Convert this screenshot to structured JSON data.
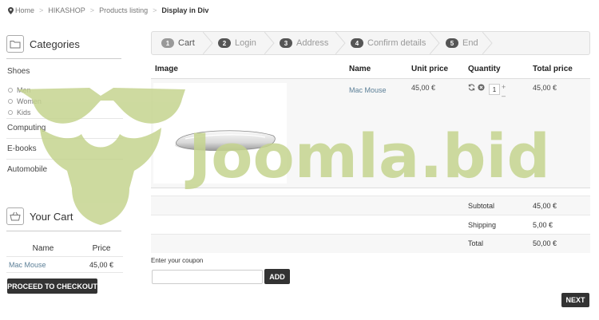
{
  "breadcrumb": {
    "items": [
      {
        "label": "Home"
      },
      {
        "label": "HIKASHOP"
      },
      {
        "label": "Products listing"
      },
      {
        "label": "Display in Div"
      }
    ]
  },
  "sidebar": {
    "categories_title": "Categories",
    "categories": [
      {
        "label": "Shoes",
        "children": [
          "Men",
          "Women",
          "Kids"
        ]
      },
      {
        "label": "Computing"
      },
      {
        "label": "E-books"
      },
      {
        "label": "Automobile"
      }
    ],
    "cart_title": "Your Cart",
    "cart_columns": {
      "name": "Name",
      "price": "Price"
    },
    "cart_items": [
      {
        "name": "Mac Mouse",
        "price": "45,00 €"
      }
    ],
    "checkout_label": "PROCEED TO CHECKOUT"
  },
  "steps": [
    {
      "num": "1",
      "label": "Cart"
    },
    {
      "num": "2",
      "label": "Login"
    },
    {
      "num": "3",
      "label": "Address"
    },
    {
      "num": "4",
      "label": "Confirm details"
    },
    {
      "num": "5",
      "label": "End"
    }
  ],
  "cart_table": {
    "headers": {
      "image": "Image",
      "name": "Name",
      "unit_price": "Unit price",
      "quantity": "Quantity",
      "total_price": "Total price"
    },
    "row": {
      "name": "Mac Mouse",
      "unit_price": "45,00 €",
      "quantity": "1",
      "total_price": "45,00 €"
    },
    "qty_plus": "+",
    "qty_minus": "–"
  },
  "summary": {
    "subtotal_label": "Subtotal",
    "subtotal": "45,00 €",
    "shipping_label": "Shipping",
    "shipping": "5,00 €",
    "total_label": "Total",
    "total": "50,00 €"
  },
  "coupon": {
    "label": "Enter your coupon",
    "value": "",
    "add_label": "ADD"
  },
  "next_label": "NEXT",
  "watermark": {
    "text": "Joomla.bid",
    "color": "#c5d48f"
  },
  "colors": {
    "link": "#5b7f97",
    "button_dark": "#333333",
    "accent_step": "#999999"
  }
}
